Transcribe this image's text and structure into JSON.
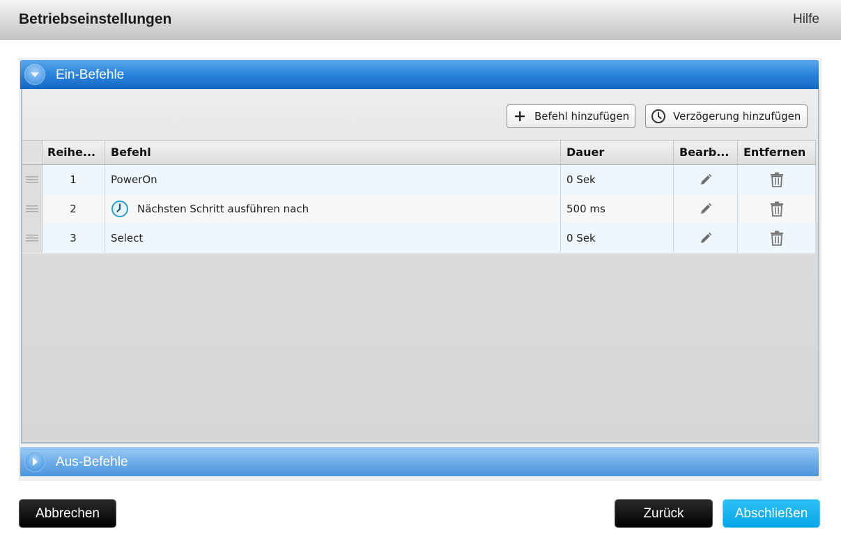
{
  "window": {
    "title": "Betriebseinstellungen",
    "help_label": "Hilfe"
  },
  "sections": {
    "on": {
      "label": "Ein-Befehle",
      "expanded": true
    },
    "off": {
      "label": "Aus-Befehle",
      "expanded": false
    }
  },
  "toolbar": {
    "add_command_label": "Befehl hinzufügen",
    "add_delay_label": "Verzögerung hinzufügen"
  },
  "table": {
    "columns": {
      "order": "Reihe...",
      "command": "Befehl",
      "duration": "Dauer",
      "edit": "Bearb...",
      "remove": "Entfernen"
    },
    "rows": [
      {
        "order": "1",
        "command": "PowerOn",
        "duration": "0 Sek",
        "is_delay": false
      },
      {
        "order": "2",
        "command": "Nächsten Schritt ausführen nach",
        "duration": "500 ms",
        "is_delay": true
      },
      {
        "order": "3",
        "command": "Select",
        "duration": "0 Sek",
        "is_delay": false
      }
    ]
  },
  "footer": {
    "cancel_label": "Abbrechen",
    "back_label": "Zurück",
    "finish_label": "Abschließen"
  },
  "colors": {
    "accent_blue": "#1568c6",
    "finish_button": "#06a6e8",
    "dark_button": "#000000"
  }
}
